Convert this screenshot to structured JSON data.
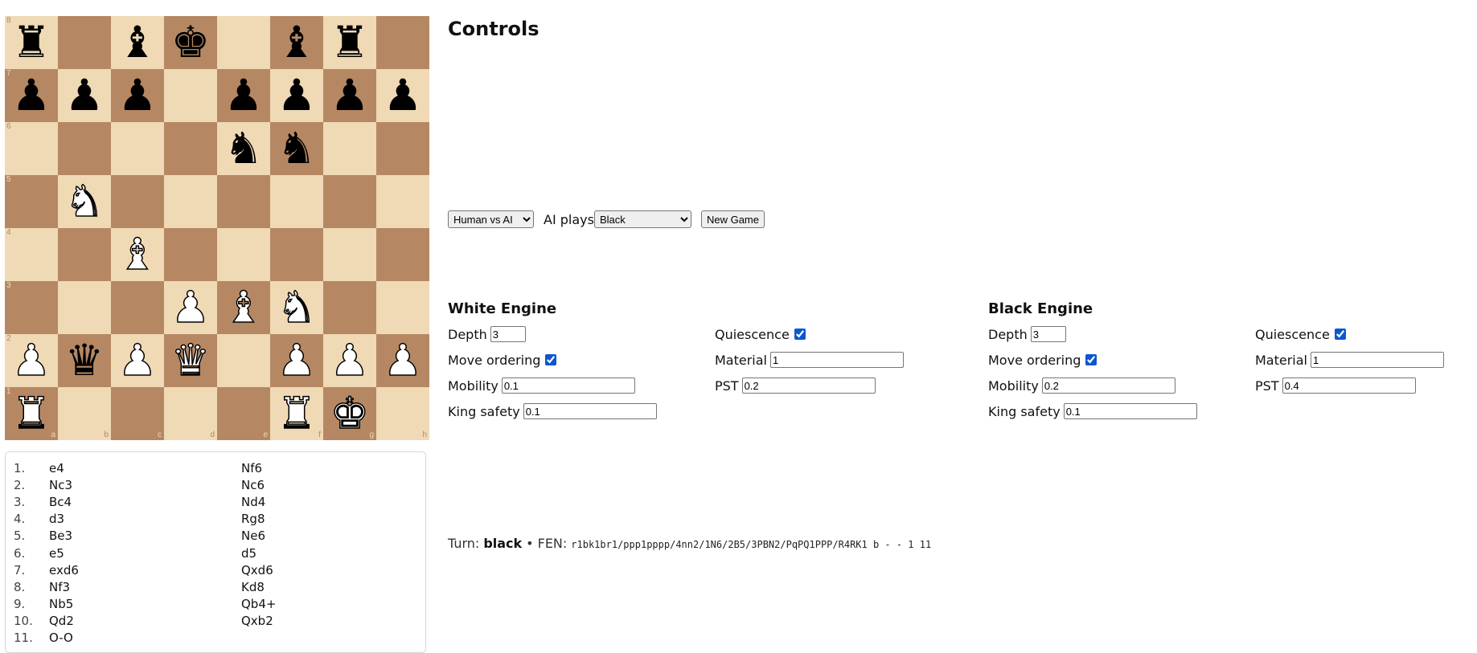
{
  "board": {
    "files": [
      "a",
      "b",
      "c",
      "d",
      "e",
      "f",
      "g",
      "h"
    ],
    "ranks": [
      "8",
      "7",
      "6",
      "5",
      "4",
      "3",
      "2",
      "1"
    ],
    "light_color": "#f0d9b5",
    "dark_color": "#b58863",
    "rows": [
      [
        "bR",
        "",
        "bB",
        "bK",
        "",
        "bB",
        "bR",
        ""
      ],
      [
        "bP",
        "bP",
        "bP",
        "",
        "bP",
        "bP",
        "bP",
        "bP"
      ],
      [
        "",
        "",
        "",
        "",
        "bN",
        "bN",
        "",
        ""
      ],
      [
        "",
        "wN",
        "",
        "",
        "",
        "",
        "",
        ""
      ],
      [
        "",
        "",
        "wB",
        "",
        "",
        "",
        "",
        ""
      ],
      [
        "",
        "",
        "",
        "wP",
        "wB",
        "wN",
        "",
        ""
      ],
      [
        "wP",
        "bQ",
        "wP",
        "wQ",
        "",
        "wP",
        "wP",
        "wP"
      ],
      [
        "wR",
        "",
        "",
        "",
        "",
        "wR",
        "wK",
        ""
      ]
    ]
  },
  "moves": [
    {
      "num": "1.",
      "white": "e4",
      "black": "Nf6"
    },
    {
      "num": "2.",
      "white": "Nc3",
      "black": "Nc6"
    },
    {
      "num": "3.",
      "white": "Bc4",
      "black": "Nd4"
    },
    {
      "num": "4.",
      "white": "d3",
      "black": "Rg8"
    },
    {
      "num": "5.",
      "white": "Be3",
      "black": "Ne6"
    },
    {
      "num": "6.",
      "white": "e5",
      "black": "d5"
    },
    {
      "num": "7.",
      "white": "exd6",
      "black": "Qxd6"
    },
    {
      "num": "8.",
      "white": "Nf3",
      "black": "Kd8"
    },
    {
      "num": "9.",
      "white": "Nb5",
      "black": "Qb4+"
    },
    {
      "num": "10.",
      "white": "Qd2",
      "black": "Qxb2"
    },
    {
      "num": "11.",
      "white": "O-O",
      "black": ""
    }
  ],
  "controls": {
    "title": "Controls",
    "mode_selected": "Human vs AI",
    "ai_plays_label": "AI plays",
    "ai_side_selected": "Black",
    "new_game_label": "New Game"
  },
  "white_engine": {
    "title": "White Engine",
    "depth_label": "Depth",
    "depth": "3",
    "quiescence_label": "Quiescence",
    "quiescence": true,
    "move_ordering_label": "Move ordering",
    "move_ordering": true,
    "material_label": "Material",
    "material": "1",
    "mobility_label": "Mobility",
    "mobility": "0.1",
    "pst_label": "PST",
    "pst": "0.2",
    "king_safety_label": "King safety",
    "king_safety": "0.1"
  },
  "black_engine": {
    "title": "Black Engine",
    "depth_label": "Depth",
    "depth": "3",
    "quiescence_label": "Quiescence",
    "quiescence": true,
    "move_ordering_label": "Move ordering",
    "move_ordering": true,
    "material_label": "Material",
    "material": "1",
    "mobility_label": "Mobility",
    "mobility": "0.2",
    "pst_label": "PST",
    "pst": "0.4",
    "king_safety_label": "King safety",
    "king_safety": "0.1"
  },
  "status": {
    "turn_label": "Turn:",
    "turn": "black",
    "separator": "•",
    "fen_label": "FEN:",
    "fen": "r1bk1br1/ppp1pppp/4nn2/1N6/2B5/3PBN2/PqPQ1PPP/R4RK1 b - - 1 11"
  }
}
